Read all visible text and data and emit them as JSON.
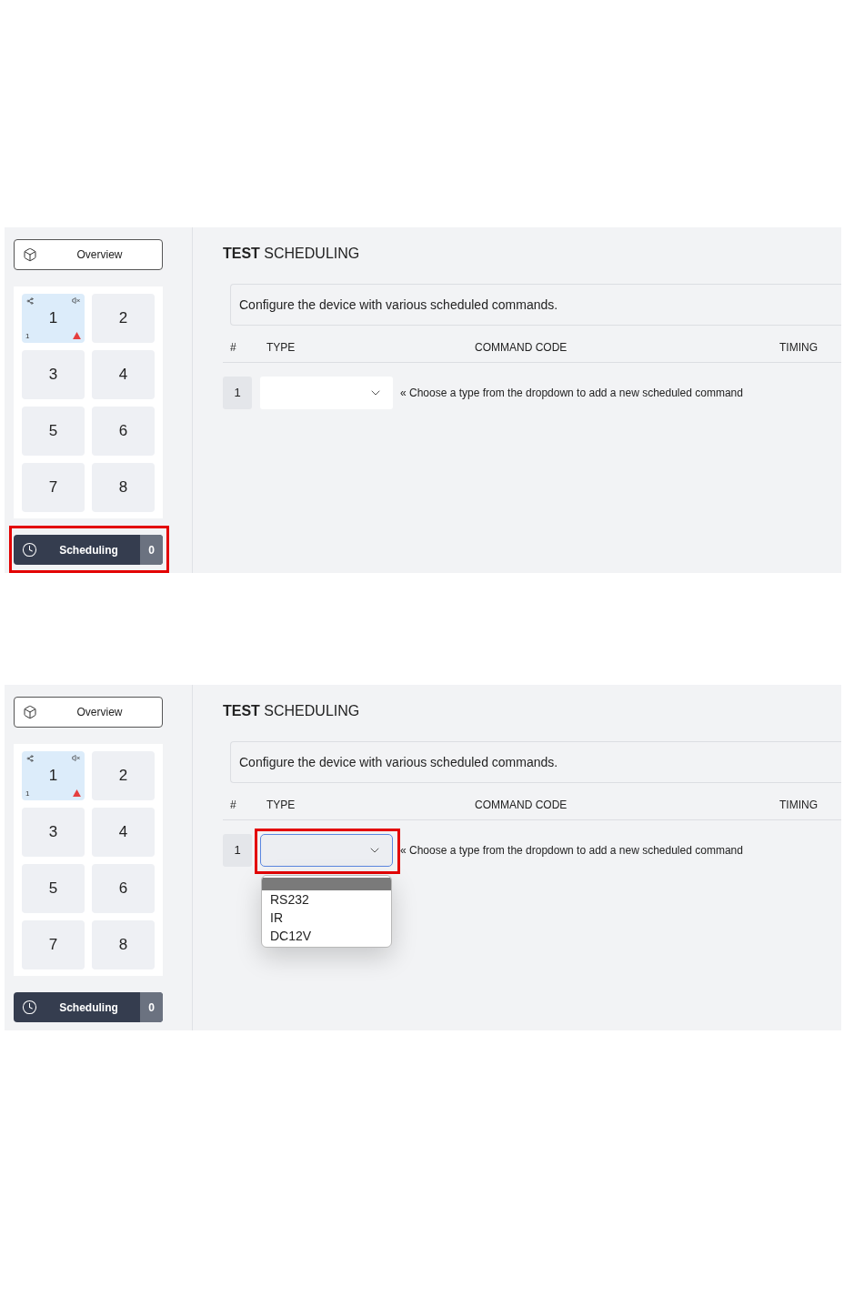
{
  "screens": [
    {
      "sidebar": {
        "overview": {
          "label": "Overview"
        },
        "channels": [
          {
            "label": "1",
            "selected": true,
            "sub_label": "1",
            "warning": true
          },
          {
            "label": "2",
            "selected": false,
            "warning": false
          },
          {
            "label": "3",
            "selected": false,
            "warning": false
          },
          {
            "label": "4",
            "selected": false,
            "warning": false
          },
          {
            "label": "5",
            "selected": false,
            "warning": false
          },
          {
            "label": "6",
            "selected": false,
            "warning": false
          },
          {
            "label": "7",
            "selected": false,
            "warning": false
          },
          {
            "label": "8",
            "selected": false,
            "warning": false
          }
        ],
        "scheduling": {
          "label": "Scheduling",
          "count": "0",
          "highlighted": true
        }
      },
      "main": {
        "title": "**TEST** SCHEDULING",
        "description": "Configure the device with various scheduled commands.",
        "table": {
          "columns": [
            "#",
            "TYPE",
            "COMMAND CODE",
            "TIMING"
          ],
          "rows": [
            {
              "number": "1",
              "type_select": {
                "focused": false,
                "highlighted": false
              },
              "hint": "« Choose a type from the dropdown to add a new scheduled command"
            }
          ]
        }
      }
    },
    {
      "sidebar": {
        "overview": {
          "label": "Overview"
        },
        "channels": [
          {
            "label": "1",
            "selected": true,
            "sub_label": "1",
            "warning": true
          },
          {
            "label": "2",
            "selected": false,
            "warning": false
          },
          {
            "label": "3",
            "selected": false,
            "warning": false
          },
          {
            "label": "4",
            "selected": false,
            "warning": false
          },
          {
            "label": "5",
            "selected": false,
            "warning": false
          },
          {
            "label": "6",
            "selected": false,
            "warning": false
          },
          {
            "label": "7",
            "selected": false,
            "warning": false
          },
          {
            "label": "8",
            "selected": false,
            "warning": false
          }
        ],
        "scheduling": {
          "label": "Scheduling",
          "count": "0",
          "highlighted": false
        }
      },
      "main": {
        "title": "**TEST** SCHEDULING",
        "description": "Configure the device with various scheduled commands.",
        "table": {
          "columns": [
            "#",
            "TYPE",
            "COMMAND CODE",
            "TIMING"
          ],
          "rows": [
            {
              "number": "1",
              "type_select": {
                "focused": true,
                "highlighted": true,
                "options": [
                  {
                    "selected": true
                  },
                  {
                    "label": "RS232",
                    "selected": false
                  },
                  {
                    "label": "IR",
                    "selected": false
                  },
                  {
                    "label": "DC12V",
                    "selected": false
                  }
                ]
              },
              "hint": "« Choose a type from the dropdown to add a new scheduled command"
            }
          ]
        }
      }
    }
  ]
}
